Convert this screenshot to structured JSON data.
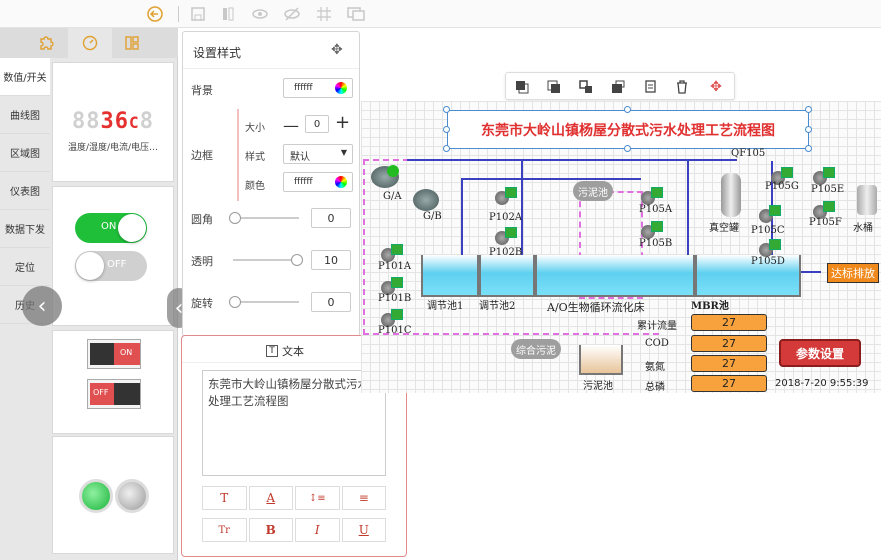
{
  "toolbar": {
    "icons": [
      "undo-icon",
      "save-icon",
      "pause-icon",
      "eye-icon",
      "eye-off-icon",
      "grid-icon",
      "monitor-icon"
    ]
  },
  "left_panel": {
    "tabs": [
      "puzzle-icon",
      "gauge-icon",
      "layout-icon"
    ],
    "categories": [
      "数值/开关",
      "曲线图",
      "区域图",
      "仪表图",
      "数据下发",
      "定位",
      "历史"
    ],
    "seg_display": {
      "dim_prefix": "88",
      "value": "36",
      "unit": "C",
      "dim_suffix": "8"
    },
    "seg_caption": "温度/湿度/电流/电压…",
    "toggle_on": "ON",
    "toggle_off": "OFF",
    "switch_on": "ON",
    "switch_off": "OFF"
  },
  "style_panel": {
    "title": "设置样式",
    "background_label": "背景",
    "background_value": "ffffff",
    "border_label": "边框",
    "size_label": "大小",
    "size_value": "0",
    "style_label": "样式",
    "style_value": "默认",
    "color_label": "颜色",
    "color_value": "ffffff",
    "radius_label": "圆角",
    "radius_value": "0",
    "opacity_label": "透明",
    "opacity_value": "10",
    "rotate_label": "旋转",
    "rotate_value": "0"
  },
  "text_panel": {
    "title": "文本",
    "content": "东莞市大岭山镇杨屋分散式污水处理工艺流程图",
    "format_buttons_row1": [
      "T",
      "A",
      "↕≡",
      "≡"
    ],
    "format_buttons_row2": [
      "Tr",
      "B",
      "I",
      "U"
    ]
  },
  "canvas": {
    "title": "东莞市大岭山镇杨屋分散式污水处理工艺流程图",
    "labels": {
      "ga": "G/A",
      "gb": "G/B",
      "p101a": "P101A",
      "p101b": "P101B",
      "p101c": "P101C",
      "p102a": "P102A",
      "p102b": "P102B",
      "p105a": "P105A",
      "p105b": "P105B",
      "p105c": "P105C",
      "p105d": "P105D",
      "p105e": "P105E",
      "p105f": "P105F",
      "p105g": "P105G",
      "qf105": "QF105",
      "vacuum_tank": "真空罐",
      "water_tank": "水桶",
      "tank1": "调节池1",
      "tank2": "调节池2",
      "ao": "A/O生物循环流化床",
      "mbr": "MBR池",
      "sludge_pool": "污泥池",
      "sludge_bubble": "污泥池",
      "mixed_sludge": "综合污泥",
      "discharge": "达标排放"
    },
    "readings": [
      {
        "label": "累计流量",
        "value": "27"
      },
      {
        "label": "COD",
        "value": "27"
      },
      {
        "label": "氨氮",
        "value": "27"
      },
      {
        "label": "总磷",
        "value": "27"
      }
    ],
    "param_button": "参数设置",
    "timestamp": "2018-7-20 9:55:39"
  },
  "colors": {
    "accent_red": "#e03030",
    "toggle_green": "#1fbf3a",
    "value_orange": "#f7a23c",
    "pipe_blue": "#3a40c0",
    "dashed_magenta": "#e070e0"
  }
}
